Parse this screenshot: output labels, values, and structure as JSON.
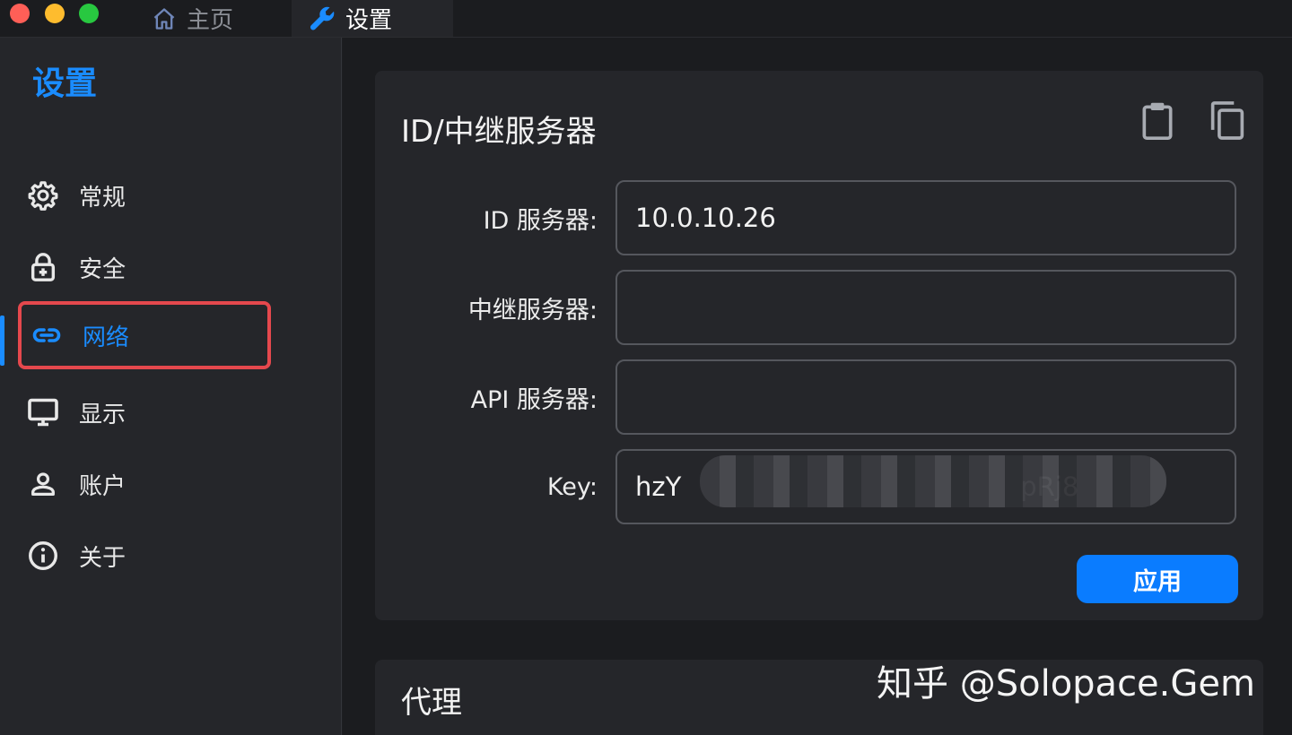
{
  "tabs": [
    {
      "label": "主页",
      "icon": "home-icon"
    },
    {
      "label": "设置",
      "icon": "wrench-icon"
    }
  ],
  "sidebar": {
    "title": "设置",
    "items": [
      {
        "label": "常规",
        "icon": "gear-icon"
      },
      {
        "label": "安全",
        "icon": "lock-icon"
      },
      {
        "label": "网络",
        "icon": "link-icon",
        "active": true
      },
      {
        "label": "显示",
        "icon": "monitor-icon"
      },
      {
        "label": "账户",
        "icon": "user-icon"
      },
      {
        "label": "关于",
        "icon": "info-icon"
      }
    ]
  },
  "server_card": {
    "title": "ID/中继服务器",
    "actions": [
      {
        "icon": "clipboard-icon"
      },
      {
        "icon": "copy-icon"
      }
    ],
    "fields": [
      {
        "label": "ID 服务器:",
        "value": "10.0.10.26"
      },
      {
        "label": "中继服务器:",
        "value": ""
      },
      {
        "label": "API 服务器:",
        "value": ""
      },
      {
        "label": "Key:",
        "value": "hzY                                         pRj8"
      }
    ],
    "apply_label": "应用"
  },
  "proxy_card": {
    "title": "代理"
  },
  "watermark": "知乎 @Solopace.Gem",
  "colors": {
    "accent": "#1a8cff",
    "button": "#0a7cff",
    "highlight_border": "#e5484d",
    "background": "#1b1c1f",
    "panel": "#25262a"
  }
}
